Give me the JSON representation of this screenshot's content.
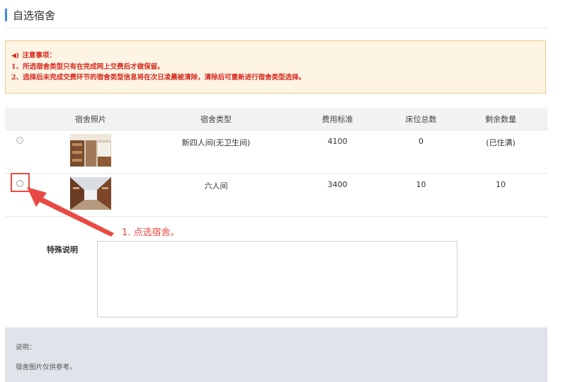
{
  "page": {
    "title": "自选宿舍"
  },
  "notice": {
    "heading": "注意事项：",
    "lines": [
      "1、所选宿舍类型只有在完成网上交费后才做保留。",
      "2、选择后未完成交费环节的宿舍类型信息将在次日凌晨被清除，清除后可重新进行宿舍类型选择。"
    ]
  },
  "table": {
    "headers": [
      "",
      "宿舍照片",
      "宿舍类型",
      "费用标准",
      "床位总数",
      "剩余数量"
    ],
    "rows": [
      {
        "type": "新四人间(无卫生间)",
        "fee": "4100",
        "total_beds": "0",
        "remaining": "(已住满)",
        "selectable": false
      },
      {
        "type": "六人间",
        "fee": "3400",
        "total_beds": "10",
        "remaining": "10",
        "selectable": true
      }
    ]
  },
  "annotation": {
    "text": "1. 点选宿舍。",
    "color": "#e84a43"
  },
  "special": {
    "label": "特殊说明",
    "value": ""
  },
  "footer": {
    "label": "说明：",
    "text": "宿舍图片仅供参考。"
  },
  "colors": {
    "accent": "#3a8ee6",
    "warning": "#d6291f",
    "annotation": "#e84a43",
    "notice_bg": "#fdf4e4"
  }
}
